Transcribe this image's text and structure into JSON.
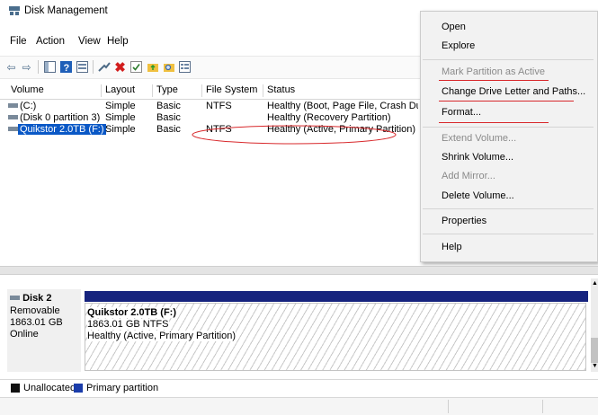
{
  "window": {
    "title": "Disk Management",
    "icon": "disk-management-icon"
  },
  "menubar": {
    "items": [
      "File",
      "Action",
      "View",
      "Help"
    ]
  },
  "toolbar": {
    "icons": [
      "back-arrow-icon",
      "forward-arrow-icon",
      "console-tree-icon",
      "help-icon",
      "properties-icon",
      "connect-icon",
      "delete-icon",
      "checkbox-icon",
      "folder-up-icon",
      "folder-search-icon",
      "view-list-icon"
    ]
  },
  "volumes": {
    "columns": [
      "Volume",
      "Layout",
      "Type",
      "File System",
      "Status"
    ],
    "rows": [
      {
        "volume": "(C:)",
        "layout": "Simple",
        "type": "Basic",
        "fs": "NTFS",
        "status": "Healthy (Boot, Page File, Crash Dum..."
      },
      {
        "volume": "(Disk 0 partition 3)",
        "layout": "Simple",
        "type": "Basic",
        "fs": "",
        "status": "Healthy (Recovery Partition)"
      },
      {
        "volume": "Quikstor 2.0TB (F:)",
        "layout": "Simple",
        "type": "Basic",
        "fs": "NTFS",
        "status": "Healthy (Active, Primary Partition)"
      }
    ]
  },
  "context_menu": {
    "items": [
      {
        "label": "Open",
        "enabled": true
      },
      {
        "label": "Explore",
        "enabled": true
      },
      {
        "label": "Mark Partition as Active",
        "enabled": false
      },
      {
        "label": "Change Drive Letter and Paths...",
        "enabled": true
      },
      {
        "label": "Format...",
        "enabled": true
      },
      {
        "label": "Extend Volume...",
        "enabled": false
      },
      {
        "label": "Shrink Volume...",
        "enabled": true
      },
      {
        "label": "Add Mirror...",
        "enabled": false
      },
      {
        "label": "Delete Volume...",
        "enabled": true
      },
      {
        "label": "Properties",
        "enabled": true
      },
      {
        "label": "Help",
        "enabled": true
      }
    ]
  },
  "disk": {
    "name": "Disk 2",
    "kind": "Removable",
    "size": "1863.01 GB",
    "state": "Online",
    "partition": {
      "name": "Quikstor 2.0TB  (F:)",
      "size_fs": "1863.01 GB NTFS",
      "status": "Healthy (Active, Primary Partition)"
    }
  },
  "legend": {
    "items": [
      {
        "label": "Unallocated",
        "color": "#111111"
      },
      {
        "label": "Primary partition",
        "color": "#1a3caa"
      }
    ]
  },
  "colors": {
    "selection": "#0a58c6",
    "annotation": "#d8282b",
    "disk_bar": "#16237e"
  }
}
